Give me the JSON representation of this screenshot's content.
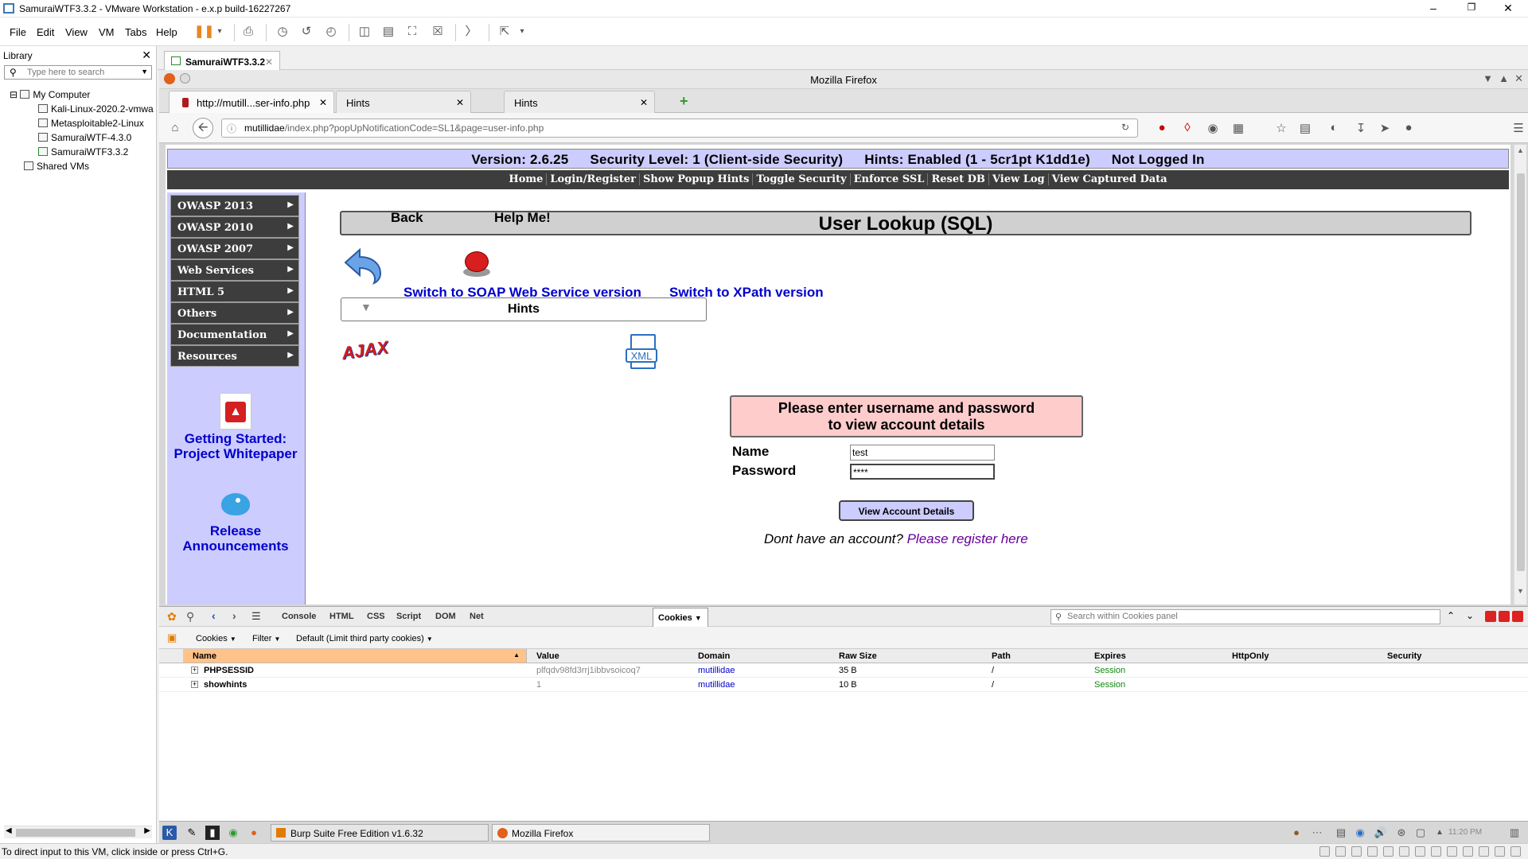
{
  "vmware": {
    "title": "SamuraiWTF3.3.2 - VMware Workstation - e.x.p build-16227267",
    "menu": [
      "File",
      "Edit",
      "View",
      "VM",
      "Tabs",
      "Help"
    ],
    "library_label": "Library",
    "search_placeholder": "Type here to search",
    "tree": {
      "root": "My Computer",
      "vms": [
        "Kali-Linux-2020.2-vmwa",
        "Metasploitable2-Linux",
        "SamuraiWTF-4.3.0",
        "SamuraiWTF3.3.2"
      ],
      "shared": "Shared VMs"
    },
    "vm_tab": "SamuraiWTF3.3.2",
    "status": "To direct input to this VM, click inside or press Ctrl+G."
  },
  "firefox": {
    "window_title": "Mozilla Firefox",
    "tabs": [
      {
        "label": "http://mutill...ser-info.php"
      },
      {
        "label": "Hints"
      },
      {
        "label": "Hints"
      }
    ],
    "url_host": "mutillidae",
    "url_path": "/index.php?popUpNotificationCode=SL1&page=user-info.php"
  },
  "page": {
    "version": "Version: 2.6.25",
    "security": "Security Level: 1 (Client-side Security)",
    "hints": "Hints: Enabled (1 - 5cr1pt K1dd1e)",
    "login": "Not Logged In",
    "topnav": [
      "Home",
      "Login/Register",
      "Show Popup Hints",
      "Toggle Security",
      "Enforce SSL",
      "Reset DB",
      "View Log",
      "View Captured Data"
    ],
    "leftnav": [
      "OWASP 2013",
      "OWASP 2010",
      "OWASP 2007",
      "Web Services",
      "HTML 5",
      "Others",
      "Documentation",
      "Resources"
    ],
    "getting_started": "Getting Started: Project Whitepaper",
    "release": "Release Announcements",
    "title": "User Lookup (SQL)",
    "back": "Back",
    "help": "Help Me!",
    "hints_box": "Hints",
    "ajax_logo": "AJAX",
    "xml_logo": "XML",
    "soap_link": "Switch to SOAP Web Service version",
    "xpath_link": "Switch to XPath version",
    "message_line1": "Please enter username and password",
    "message_line2": "to view account details",
    "name_label": "Name",
    "password_label": "Password",
    "name_value": "test",
    "password_value": "****",
    "button": "View Account Details",
    "register_prefix": "Dont have an account?",
    "register_link": "Please register here"
  },
  "firebug": {
    "tabs": [
      "Console",
      "HTML",
      "CSS",
      "Script",
      "DOM",
      "Net"
    ],
    "active_tab": "Cookies",
    "search_placeholder": "Search within Cookies panel",
    "sub": [
      "Cookies",
      "Filter",
      "Default (Limit third party cookies)"
    ],
    "columns": [
      "Name",
      "Value",
      "Domain",
      "Raw Size",
      "Path",
      "Expires",
      "HttpOnly",
      "Security"
    ],
    "rows": [
      {
        "name": "PHPSESSID",
        "value": "plfqdv98fd3rrj1ibbvsoicoq7",
        "domain": "mutillidae",
        "size": "35 B",
        "path": "/",
        "expires": "Session"
      },
      {
        "name": "showhints",
        "value": "1",
        "domain": "mutillidae",
        "size": "10 B",
        "path": "/",
        "expires": "Session"
      }
    ]
  },
  "guest_taskbar": {
    "tasks": [
      "Burp Suite Free Edition v1.6.32",
      "Mozilla Firefox"
    ],
    "clock": "11:20 PM"
  },
  "colors": {
    "version_bar": "#ccccff",
    "nav_dark": "#3d3d3d",
    "message_bg": "#ffcccc",
    "link_blue": "#0000cc"
  }
}
